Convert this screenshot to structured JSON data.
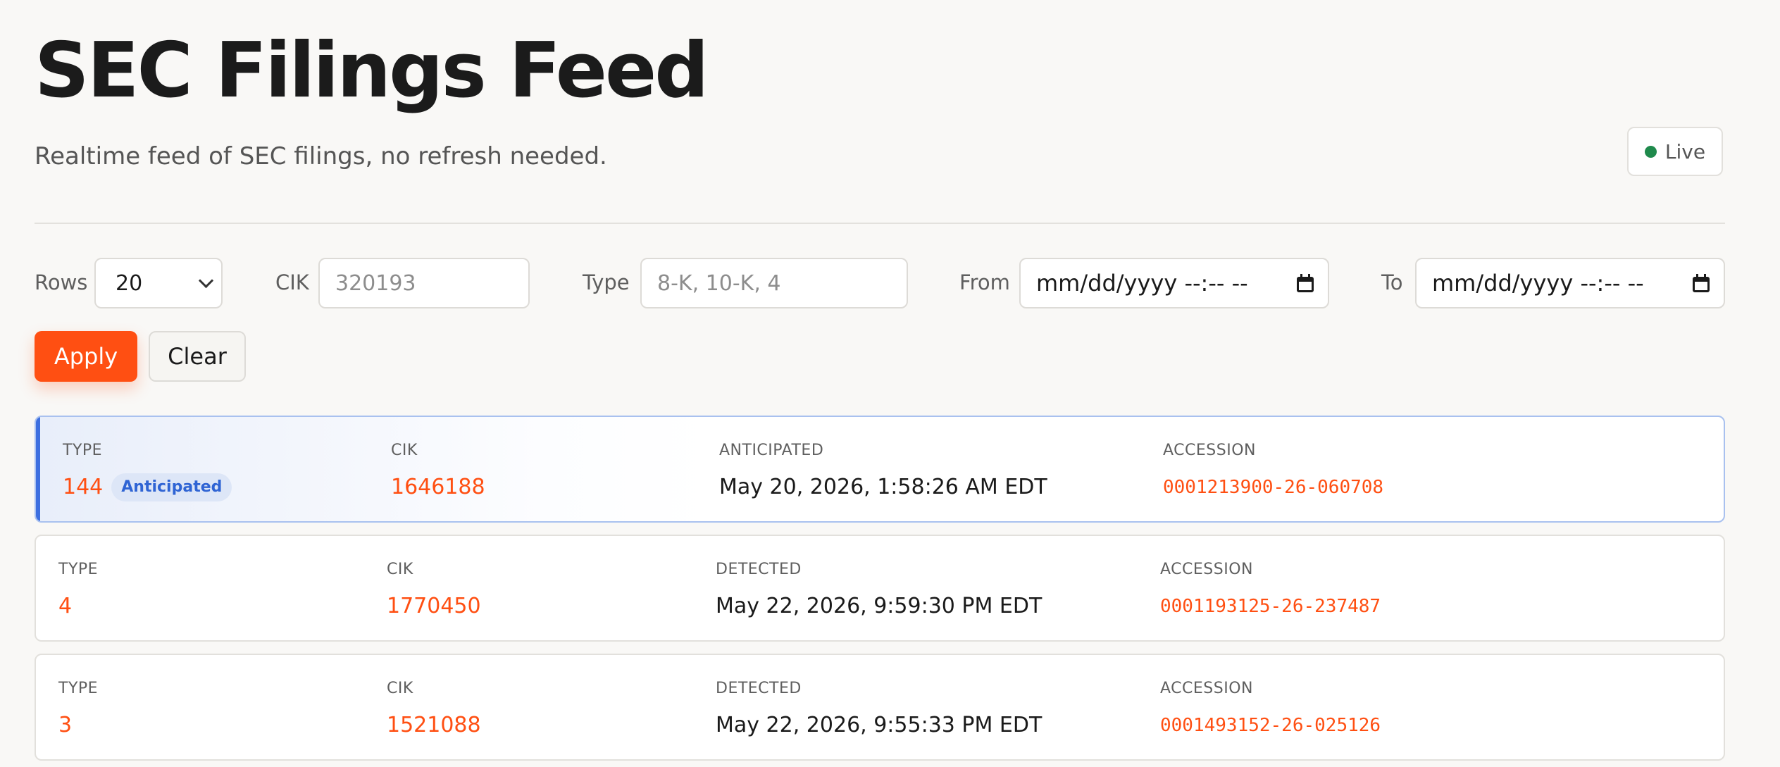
{
  "header": {
    "title": "SEC Filings Feed",
    "subtitle": "Realtime feed of SEC filings, no refresh needed.",
    "status_label": "Live",
    "status_color": "#1f8a4c"
  },
  "filters": {
    "rows_label": "Rows",
    "rows_value": "20",
    "cik_label": "CIK",
    "cik_placeholder": "320193",
    "type_label": "Type",
    "type_placeholder": "8-K, 10-K, 4",
    "from_label": "From",
    "from_placeholder": "mm/dd/yyyy --:-- --",
    "to_label": "To",
    "to_placeholder": "mm/dd/yyyy --:-- --",
    "apply_label": "Apply",
    "clear_label": "Clear"
  },
  "colors": {
    "accent": "#ff4f12",
    "anticipated_accent": "#3d6fe0"
  },
  "filings": [
    {
      "type_label": "TYPE",
      "type": "144",
      "badge": "Anticipated",
      "cik_label": "CIK",
      "cik": "1646188",
      "date_label": "ANTICIPATED",
      "date": "May 20, 2026, 1:58:26 AM EDT",
      "accession_label": "ACCESSION",
      "accession": "0001213900-26-060708"
    },
    {
      "type_label": "TYPE",
      "type": "4",
      "cik_label": "CIK",
      "cik": "1770450",
      "date_label": "DETECTED",
      "date": "May 22, 2026, 9:59:30 PM EDT",
      "accession_label": "ACCESSION",
      "accession": "0001193125-26-237487"
    },
    {
      "type_label": "TYPE",
      "type": "3",
      "cik_label": "CIK",
      "cik": "1521088",
      "date_label": "DETECTED",
      "date": "May 22, 2026, 9:55:33 PM EDT",
      "accession_label": "ACCESSION",
      "accession": "0001493152-26-025126"
    }
  ]
}
